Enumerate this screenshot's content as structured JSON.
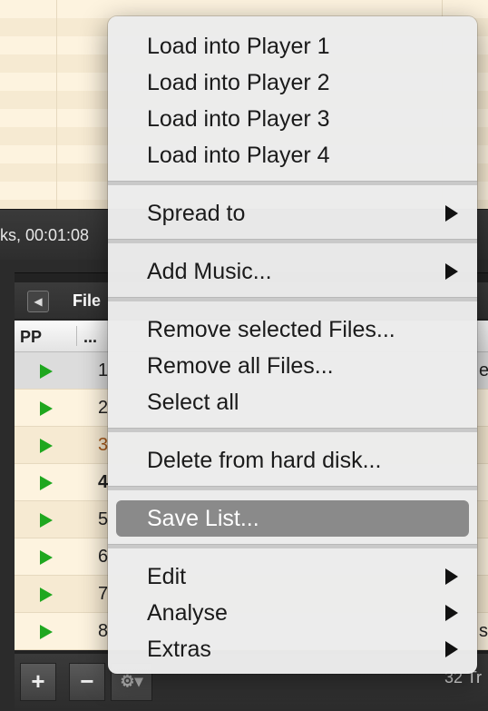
{
  "status": {
    "text": "ks,  00:01:08"
  },
  "panel": {
    "title": "File"
  },
  "columns": {
    "pp": "PP",
    "idx": "..."
  },
  "rows": [
    {
      "num": "1",
      "style": "normal",
      "trail": "e"
    },
    {
      "num": "2",
      "style": "normal",
      "trail": ""
    },
    {
      "num": "3",
      "style": "orange",
      "trail": ""
    },
    {
      "num": "4",
      "style": "bold",
      "trail": ""
    },
    {
      "num": "5",
      "style": "normal",
      "trail": ""
    },
    {
      "num": "6",
      "style": "normal",
      "trail": ""
    },
    {
      "num": "7",
      "style": "normal",
      "trail": ""
    },
    {
      "num": "8",
      "style": "normal",
      "trail": "s"
    }
  ],
  "bottom": {
    "add": "+",
    "remove": "−",
    "gear": "⚙▾",
    "tracks": "32 Tr"
  },
  "menu": {
    "load1": "Load into Player 1",
    "load2": "Load into Player 2",
    "load3": "Load into Player 3",
    "load4": "Load into Player 4",
    "spread": "Spread to",
    "add_music": "Add Music...",
    "remove_selected": "Remove selected Files...",
    "remove_all": "Remove all Files...",
    "select_all": "Select all",
    "delete": "Delete from hard disk...",
    "save_list": "Save List...",
    "edit": "Edit",
    "analyse": "Analyse",
    "extras": "Extras"
  },
  "colors": {
    "play": "#1fa71f",
    "highlight": "#8a8a8a"
  }
}
